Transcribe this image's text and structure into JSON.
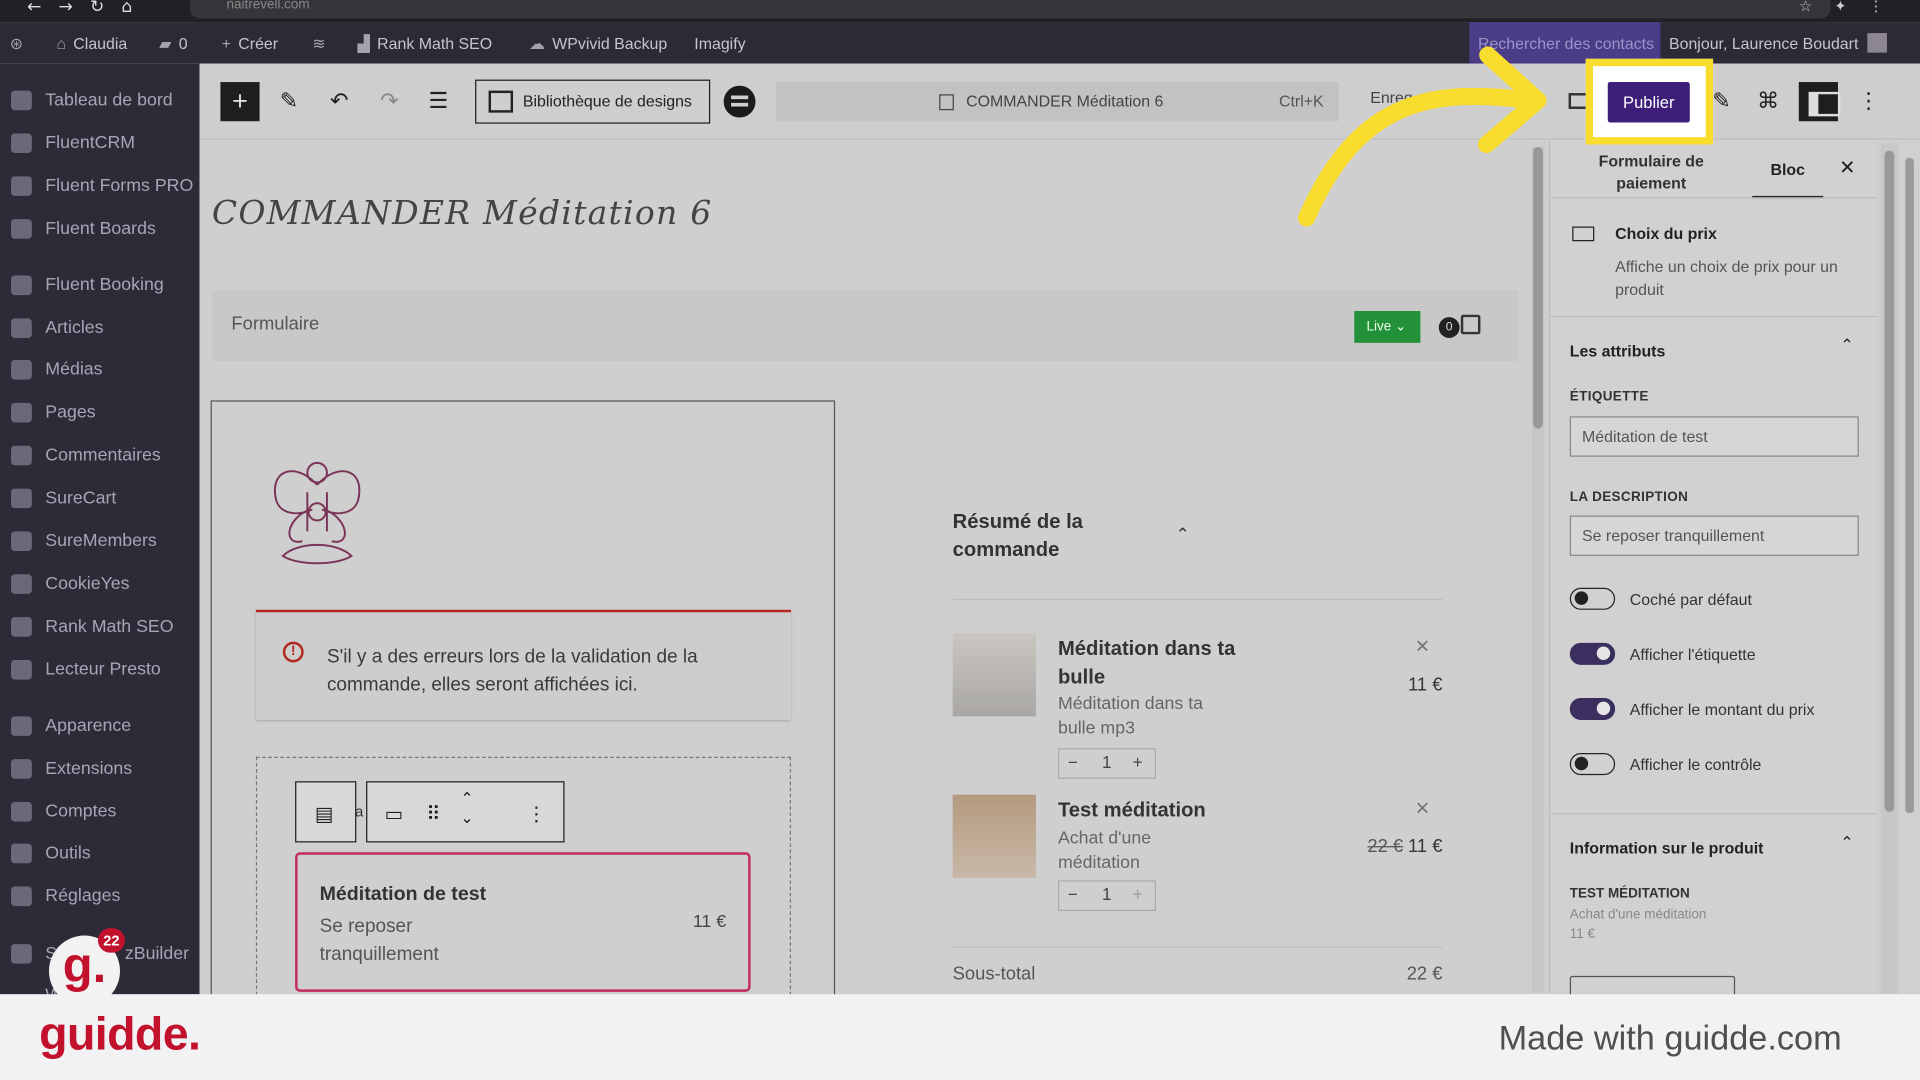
{
  "browser": {
    "url": "naitrevell.com"
  },
  "adminbar": {
    "site": "Claudia",
    "comments": "0",
    "new": "Créer",
    "rankmath": "Rank Math SEO",
    "wpvivid": "WPvivid Backup",
    "imagify": "Imagify",
    "search_contacts": "Rechercher des contacts",
    "greeting": "Bonjour, Laurence Boudart"
  },
  "sidebar": {
    "items": [
      {
        "label": "Tableau de bord"
      },
      {
        "label": "FluentCRM"
      },
      {
        "label": "Fluent Forms PRO"
      },
      {
        "label": "Fluent Boards"
      },
      {
        "label": "Fluent Booking"
      },
      {
        "label": "Articles"
      },
      {
        "label": "Médias"
      },
      {
        "label": "Pages"
      },
      {
        "label": "Commentaires"
      },
      {
        "label": "SureCart"
      },
      {
        "label": "SureMembers"
      },
      {
        "label": "CookieYes"
      },
      {
        "label": "Rank Math SEO"
      },
      {
        "label": "Lecteur Presto"
      },
      {
        "label": "Apparence"
      },
      {
        "label": "Extensions"
      },
      {
        "label": "Comptes"
      },
      {
        "label": "Outils"
      },
      {
        "label": "Réglages"
      },
      {
        "label": "S"
      },
      {
        "label": "zBuilder"
      },
      {
        "label": "W"
      }
    ]
  },
  "toolbar": {
    "library": "Bibliothèque de designs",
    "command": "COMMANDER Méditation 6",
    "shortcut": "Ctrl+K",
    "save": "Enreg",
    "publish": "Publier"
  },
  "canvas": {
    "page_title": "COMMANDER Méditation 6",
    "form_label": "Formulaire",
    "live": "Live",
    "cart_count": "0",
    "error_text": "S'il y a des erreurs lors de la validation de la commande, elles seront affichées ici.",
    "block_letter": "a",
    "price_name": "Méditation de test",
    "price_desc": "Se reposer tranquillement",
    "price_amount": "11 €",
    "summary_title": "Résumé de la commande",
    "items": [
      {
        "title": "Méditation dans ta bulle",
        "sub": "Méditation dans ta bulle mp3",
        "qty": "1",
        "old_price": "",
        "price": "11 €"
      },
      {
        "title": "Test méditation",
        "sub": "Achat d'une méditation",
        "qty": "1",
        "old_price": "22 €",
        "price": "11 €"
      }
    ],
    "subtotal_label": "Sous-total",
    "subtotal_value": "22 €"
  },
  "panel": {
    "tab_form": "Formulaire de paiement",
    "tab_block": "Bloc",
    "block_name": "Choix du prix",
    "block_desc": "Affiche un choix de prix pour un produit",
    "attributes": "Les attributs",
    "label_field": "ÉTIQUETTE",
    "label_value": "Méditation de test",
    "desc_field": "LA DESCRIPTION",
    "desc_value": "Se reposer tranquillement",
    "toggles": [
      {
        "label": "Coché par défaut",
        "on": false
      },
      {
        "label": "Afficher l'étiquette",
        "on": true
      },
      {
        "label": "Afficher le montant du prix",
        "on": true
      },
      {
        "label": "Afficher le contrôle",
        "on": false
      }
    ],
    "product_info": "Information sur le produit",
    "product_name": "TEST MÉDITATION",
    "product_desc": "Achat d'une méditation",
    "product_price": "11 €"
  },
  "footer": {
    "brand": "guidde.",
    "made_with": "Made with guidde.com",
    "badge_letter": "g.",
    "badge_count": "22"
  },
  "colors": {
    "publish": "#3d1f7a",
    "highlight": "#f9dd2e",
    "brand_red": "#c2112c"
  }
}
